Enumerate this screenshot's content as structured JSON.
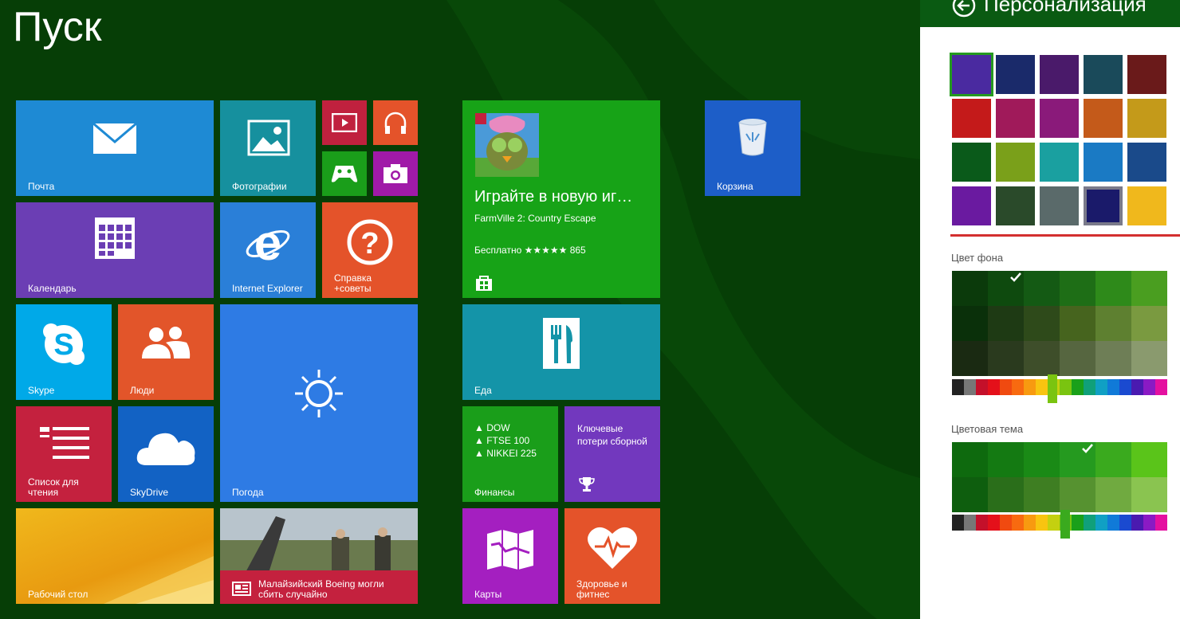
{
  "start": {
    "title": "Пуск"
  },
  "tiles": {
    "mail": "Почта",
    "photos": "Фотографии",
    "calendar": "Календарь",
    "ie": "Internet Explorer",
    "help": "Справка\n+советы",
    "skype": "Skype",
    "people": "Люди",
    "weather": "Погода",
    "reading": "Список для\nчтения",
    "skydrive": "SkyDrive",
    "desktop": "Рабочий стол",
    "news": "Малайзийский Boeing могли\nсбить случайно",
    "store": {
      "headline": "Играйте в новую иг…",
      "app": "FarmVille 2: Country Escape",
      "price": "Бесплатно ★★★★★ 865"
    },
    "food": "Еда",
    "finance": {
      "tickers": [
        "▲ DOW",
        "▲ FTSE 100",
        "▲ NIKKEI 225"
      ],
      "label": "Финансы"
    },
    "sport": "Ключевые\nпотери сборной",
    "maps": "Карты",
    "health": "Здоровье и\nфитнес",
    "recycle": "Корзина"
  },
  "charm": {
    "title": "Персонализация",
    "background_color_label": "Цвет фона",
    "theme_color_label": "Цветовая тема",
    "selected_background_color": "#0e4a0e",
    "selected_theme_color": "#259a1f",
    "accent_underline": "#d32f2f"
  },
  "colors": {
    "bg": "#063e06",
    "mail": "#1e8ad4",
    "photos": "#16909e",
    "calendar": "#6b3eb4",
    "ie": "#2a7fd8",
    "help": "#e4532a",
    "skype": "#00a9e8",
    "people": "#e2552a",
    "weather": "#2e7be4",
    "reading": "#c4213e",
    "skydrive": "#1262c4",
    "store": "#17a317",
    "food": "#1494a8",
    "finance": "#1a9e1a",
    "sport": "#7238be",
    "maps": "#a41fc0",
    "health": "#e4532a",
    "recycle": "#1d5ec8",
    "video": "#c0213e",
    "music": "#e4532a",
    "games": "#1a9e1a",
    "camera": "#a01aa8"
  }
}
